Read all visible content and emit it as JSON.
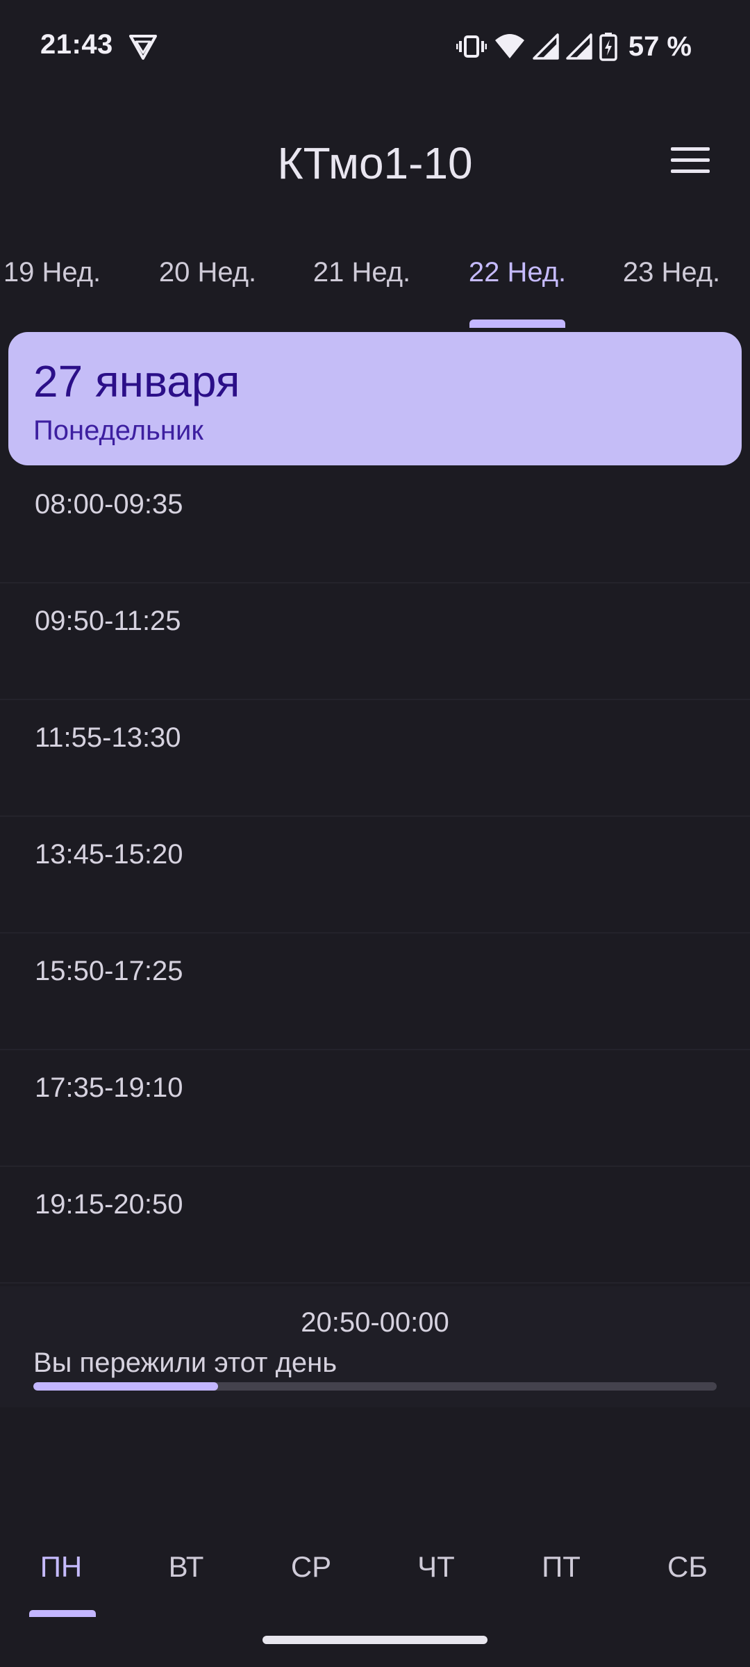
{
  "status_bar": {
    "time": "21:43",
    "app_icon": "shield-vpn-icon",
    "icons": [
      "vibrate-icon",
      "wifi-icon",
      "signal-icon",
      "signal-icon",
      "battery-charging-icon"
    ],
    "battery": "57 %"
  },
  "app_bar": {
    "title": "КТмо1-10",
    "menu_icon": "hamburger-menu-icon"
  },
  "weeks": {
    "tabs": [
      {
        "label": "19 Нед."
      },
      {
        "label": "20 Нед."
      },
      {
        "label": "21 Нед."
      },
      {
        "label": "22 Нед."
      },
      {
        "label": "23 Нед."
      }
    ],
    "selected": "22 Нед."
  },
  "day": {
    "date": "27 января",
    "weekday": "Понедельник"
  },
  "lessons": [
    {
      "time": "08:00-09:35"
    },
    {
      "time": "09:50-11:25"
    },
    {
      "time": "11:55-13:30"
    },
    {
      "time": "13:45-15:20"
    },
    {
      "time": "15:50-17:25"
    },
    {
      "time": "17:35-19:10"
    },
    {
      "time": "19:15-20:50"
    }
  ],
  "after_hours": {
    "time": "20:50-00:00",
    "caption": "Вы пережили этот день",
    "progress": 0.27
  },
  "day_tabs": {
    "tabs": [
      {
        "label": "ПН"
      },
      {
        "label": "ВТ"
      },
      {
        "label": "СР"
      },
      {
        "label": "ЧТ"
      },
      {
        "label": "ПТ"
      },
      {
        "label": "СБ"
      }
    ],
    "selected": "ПН"
  },
  "colors": {
    "background": "#1c1b22",
    "accent": "#c3b6ff",
    "card": "#c5bdf7",
    "card_text": "#2b0f88"
  }
}
